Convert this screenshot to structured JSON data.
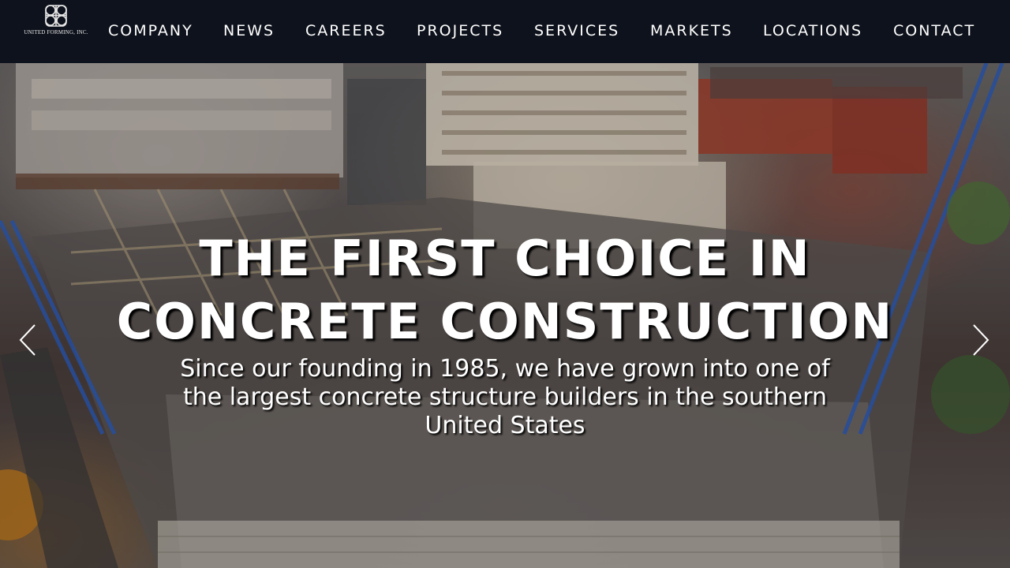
{
  "header": {
    "logo_text": "UNITED FORMING, INC.",
    "nav": [
      {
        "label": "COMPANY"
      },
      {
        "label": "NEWS"
      },
      {
        "label": "CAREERS"
      },
      {
        "label": "PROJECTS"
      },
      {
        "label": "SERVICES"
      },
      {
        "label": "MARKETS"
      },
      {
        "label": "LOCATIONS"
      },
      {
        "label": "CONTACT"
      }
    ]
  },
  "hero": {
    "title_line1": "THE FIRST CHOICE IN",
    "title_line2": "CONCRETE CONSTRUCTION",
    "subtitle": "Since our founding in 1985, we have grown into one of the largest concrete structure builders in the southern United States",
    "prev_icon": "chevron-left-icon",
    "next_icon": "chevron-right-icon"
  },
  "colors": {
    "nav_background": "#0e121c",
    "nav_text": "#ffffff",
    "hero_text": "#ffffff"
  }
}
